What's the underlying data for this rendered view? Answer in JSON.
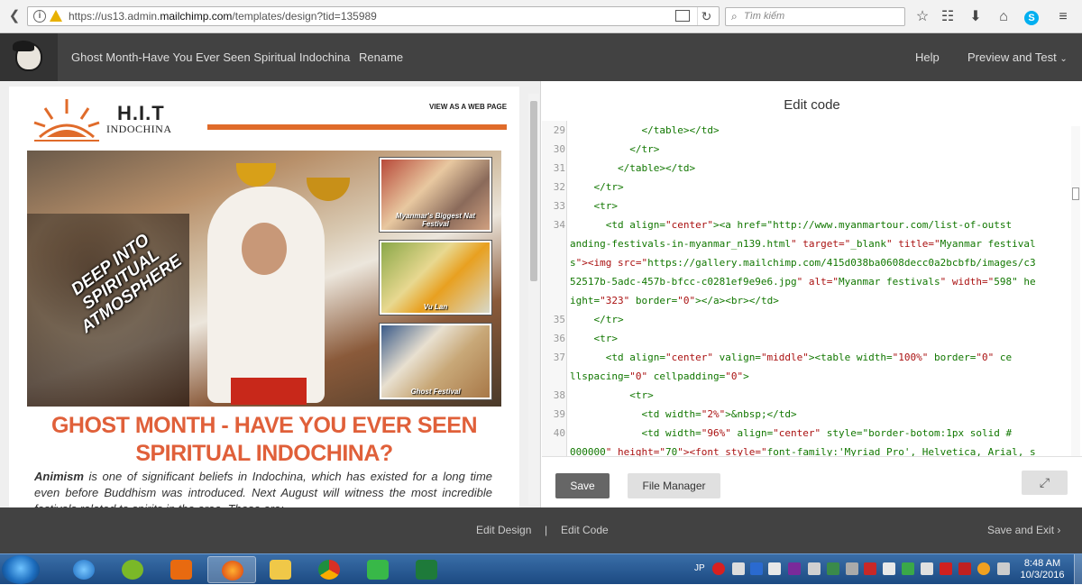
{
  "browser": {
    "url_prefix": "https://us13.admin.",
    "url_domain": "mailchimp.com",
    "url_path": "/templates/design?tid=135989",
    "search_placeholder": "Tìm kiếm"
  },
  "header": {
    "campaign_title": "Ghost Month-Have You Ever Seen Spiritual Indochina",
    "rename": "Rename",
    "help": "Help",
    "preview": "Preview and Test"
  },
  "email": {
    "brand_name": "H.I.T",
    "brand_sub": "INDOCHINA",
    "view_web": "VIEW AS A WEB PAGE",
    "hero_tagline": "DEEP INTO SPIRITUAL ATMOSPHERE",
    "thumbs": [
      "Myanmar's Biggest Nat Festival",
      "Vu Lan",
      "Ghost Festival"
    ],
    "headline": "GHOST MONTH - HAVE YOU EVER SEEN SPIRITUAL INDOCHINA?",
    "intro_bold": "Animism",
    "intro_rest": " is one of significant beliefs in Indochina, which has existed for a long time even before Buddhism was introduced. Next August will witness the most incredible festivals related to spirits in the area. These are:"
  },
  "code_panel": {
    "heading": "Edit code",
    "lines": [
      {
        "n": "29",
        "t": "            </table></td>"
      },
      {
        "n": "30",
        "t": "          </tr>"
      },
      {
        "n": "31",
        "t": "        </table></td>"
      },
      {
        "n": "32",
        "t": "    </tr>"
      },
      {
        "n": "33",
        "t": "    <tr>"
      },
      {
        "n": "34",
        "t": "      <td align=\"center\"><a href=\"http://www.myanmartour.com/list-of-outst"
      },
      {
        "n": "",
        "t": "anding-festivals-in-myanmar_n139.html\" target=\"_blank\" title=\"Myanmar festival"
      },
      {
        "n": "",
        "t": "s\"><img src=\"https://gallery.mailchimp.com/415d038ba0608decc0a2bcbfb/images/c3"
      },
      {
        "n": "",
        "t": "52517b-5adc-457b-bfcc-c0281ef9e9e6.jpg\" alt=\"Myanmar festivals\" width=\"598\" he"
      },
      {
        "n": "",
        "t": "ight=\"323\" border=\"0\"></a><br></td>"
      },
      {
        "n": "35",
        "t": "    </tr>"
      },
      {
        "n": "36",
        "t": "    <tr>"
      },
      {
        "n": "37",
        "t": "      <td align=\"center\" valign=\"middle\"><table width=\"100%\" border=\"0\" ce"
      },
      {
        "n": "",
        "t": "llspacing=\"0\" cellpadding=\"0\">"
      },
      {
        "n": "38",
        "t": "          <tr>"
      },
      {
        "n": "39",
        "t": "            <td width=\"2%\">&nbsp;</td>"
      },
      {
        "n": "40",
        "t": "            <td width=\"96%\" align=\"center\" style=\"border-botom:1px solid #"
      },
      {
        "n": "",
        "t": "000000\" height=\"70\"><font style=\"font-family:'Myriad Pro', Helvetica, Arial, s"
      }
    ],
    "save": "Save",
    "file_manager": "File Manager"
  },
  "footer": {
    "edit_design": "Edit Design",
    "separator": "|",
    "edit_code": "Edit Code",
    "save_exit": "Save and Exit"
  },
  "taskbar": {
    "ime": "JP",
    "time": "8:48 AM",
    "date": "10/3/2016"
  },
  "colors": {
    "accent_orange": "#e0603a",
    "header_bg": "#424242",
    "taskbar_blue": "#1c4a82"
  }
}
